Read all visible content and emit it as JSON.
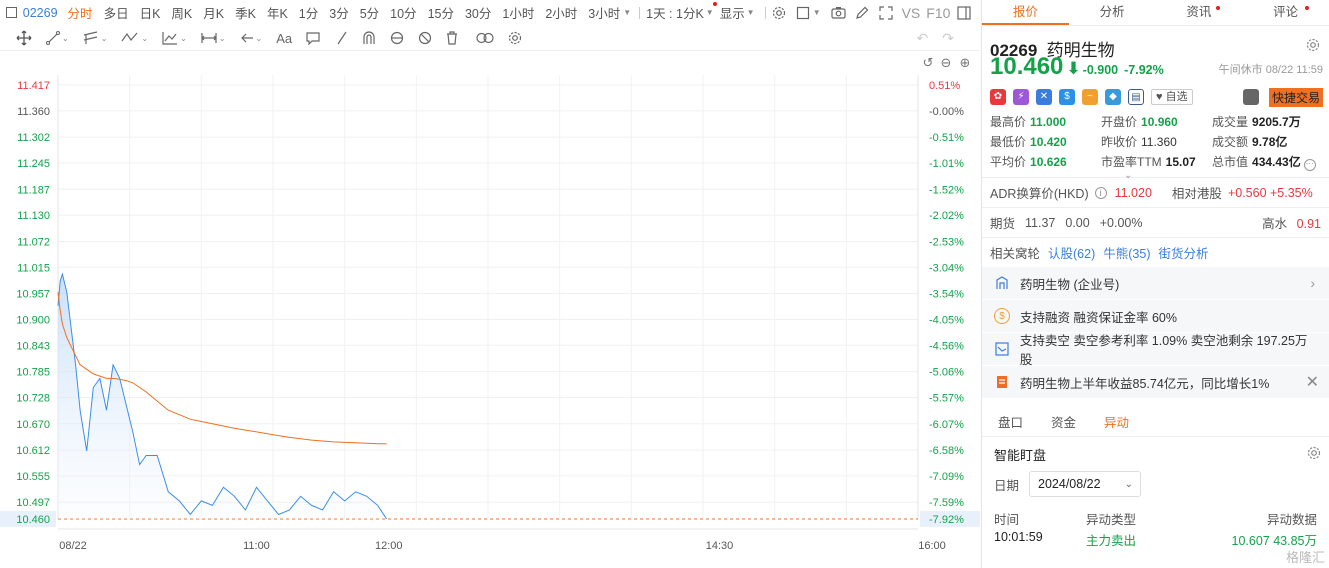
{
  "toolbar": {
    "code": "02269",
    "periods": [
      "分时",
      "多日",
      "日K",
      "周K",
      "月K",
      "季K",
      "年K",
      "1分",
      "3分",
      "5分",
      "10分",
      "15分",
      "30分",
      "1小时",
      "2小时",
      "3小时"
    ],
    "active_period": "分时",
    "interval_select": "1天 : 1分K",
    "display_label": "显示",
    "vs_label": "VS",
    "f10_label": "F10"
  },
  "chart": {
    "left_ticks": [
      "11.417",
      "11.360",
      "11.302",
      "11.245",
      "11.187",
      "11.130",
      "11.072",
      "11.015",
      "10.957",
      "10.900",
      "10.843",
      "10.785",
      "10.728",
      "10.670",
      "10.612",
      "10.555",
      "10.497",
      "10.460"
    ],
    "right_ticks": [
      "0.51%",
      "-0.00%",
      "-0.51%",
      "-1.01%",
      "-1.52%",
      "-2.02%",
      "-2.53%",
      "-3.04%",
      "-3.54%",
      "-4.05%",
      "-4.56%",
      "-5.06%",
      "-5.57%",
      "-6.07%",
      "-6.58%",
      "-7.09%",
      "-7.59%",
      "-7.92%"
    ],
    "x_ticks": [
      "08/22",
      "11:00",
      "12:00",
      "14:30",
      "16:00"
    ],
    "colors": {
      "up": "#e8383d",
      "down": "#13a24a",
      "price_line": "#3b8ee6",
      "avg_line": "#f07020"
    }
  },
  "chart_data": {
    "type": "line",
    "title": "",
    "xlabel": "",
    "ylabel": "",
    "ylim": [
      10.46,
      11.417
    ],
    "x": [
      "09:30",
      "09:31",
      "09:32",
      "09:34",
      "09:36",
      "09:38",
      "09:40",
      "09:43",
      "09:46",
      "09:49",
      "09:52",
      "09:55",
      "09:58",
      "10:01",
      "10:04",
      "10:07",
      "10:10",
      "10:15",
      "10:20",
      "10:25",
      "10:30",
      "10:35",
      "10:40",
      "10:45",
      "10:50",
      "10:55",
      "11:00",
      "11:05",
      "11:10",
      "11:15",
      "11:20",
      "11:25",
      "11:30",
      "11:35",
      "11:40",
      "11:45",
      "11:50",
      "11:55",
      "11:59"
    ],
    "series": [
      {
        "values": [
          10.93,
          10.985,
          11.0,
          10.96,
          10.88,
          10.8,
          10.7,
          10.61,
          10.75,
          10.77,
          10.7,
          10.8,
          10.77,
          10.71,
          10.65,
          10.58,
          10.6,
          10.6,
          10.52,
          10.5,
          10.47,
          10.5,
          10.49,
          10.53,
          10.51,
          10.48,
          10.53,
          10.5,
          10.47,
          10.48,
          10.51,
          10.49,
          10.48,
          10.52,
          10.5,
          10.52,
          10.51,
          10.49,
          10.46
        ]
      },
      {
        "values": [
          10.96,
          10.92,
          10.89,
          10.86,
          10.84,
          10.82,
          10.8,
          10.79,
          10.78,
          10.775,
          10.77,
          10.77,
          10.768,
          10.765,
          10.76,
          10.75,
          10.74,
          10.72,
          10.7,
          10.69,
          10.68,
          10.675,
          10.67,
          10.665,
          10.66,
          10.656,
          10.652,
          10.648,
          10.644,
          10.64,
          10.637,
          10.634,
          10.632,
          10.63,
          10.629,
          10.628,
          10.627,
          10.626,
          10.626
        ]
      }
    ],
    "x_tick_labels": [
      "08/22",
      "11:00",
      "12:00",
      "14:30",
      "16:00"
    ],
    "grid": true
  },
  "panel": {
    "tabs": [
      "报价",
      "分析",
      "资讯",
      "评论"
    ],
    "active_tab": "报价",
    "code": "02269",
    "name": "药明生物",
    "price": "10.460",
    "change": "-0.900",
    "change_pct": "-7.92%",
    "market_status": "午间休市 08/22 11:59",
    "fav_label": "自选",
    "fast_trade": "快捷交易",
    "stats": [
      {
        "label": "最高价",
        "value": "11.000",
        "tone": "g"
      },
      {
        "label": "开盘价",
        "value": "10.960",
        "tone": "g"
      },
      {
        "label": "成交量",
        "value": "9205.7万",
        "tone": "d"
      },
      {
        "label": "最低价",
        "value": "10.420",
        "tone": "g"
      },
      {
        "label": "昨收价",
        "value": "11.360",
        "tone": "n"
      },
      {
        "label": "成交额",
        "value": "9.78亿",
        "tone": "d"
      },
      {
        "label": "平均价",
        "value": "10.626",
        "tone": "g"
      },
      {
        "label": "市盈率TTM",
        "value": "15.07",
        "tone": "d"
      },
      {
        "label": "总市值",
        "value": "434.43亿",
        "tone": "d"
      }
    ],
    "adr_label": "ADR换算价(HKD)",
    "adr_value": "11.020",
    "rel_label": "相对港股",
    "rel_value": "+0.560 +5.35%",
    "futures_label": "期货",
    "futures_price": "11.37",
    "futures_chg": "0.00",
    "futures_pct": "+0.00%",
    "premium_label": "高水",
    "premium_value": "0.91",
    "warrant_label": "相关窝轮",
    "warrant_call": "认股(62)",
    "warrant_bull": "牛熊(35)",
    "warrant_street": "街货分析",
    "news": [
      "药明生物 (企业号)",
      "支持融资 融资保证金率 60%",
      "支持卖空 卖空参考利率 1.09% 卖空池剩余 197.25万股",
      "药明生物上半年收益85.74亿元，同比增长1%"
    ],
    "subtabs": [
      "盘口",
      "资金",
      "异动"
    ],
    "active_subtab": "异动",
    "smart_title": "智能盯盘",
    "date_label": "日期",
    "date_value": "2024/08/22",
    "table_headers": [
      "时间",
      "异动类型",
      "异动数据"
    ],
    "table_rows": [
      {
        "time": "10:01:59",
        "type": "主力卖出",
        "data": "10.607 43.85万"
      }
    ],
    "watermark": "格隆汇"
  }
}
